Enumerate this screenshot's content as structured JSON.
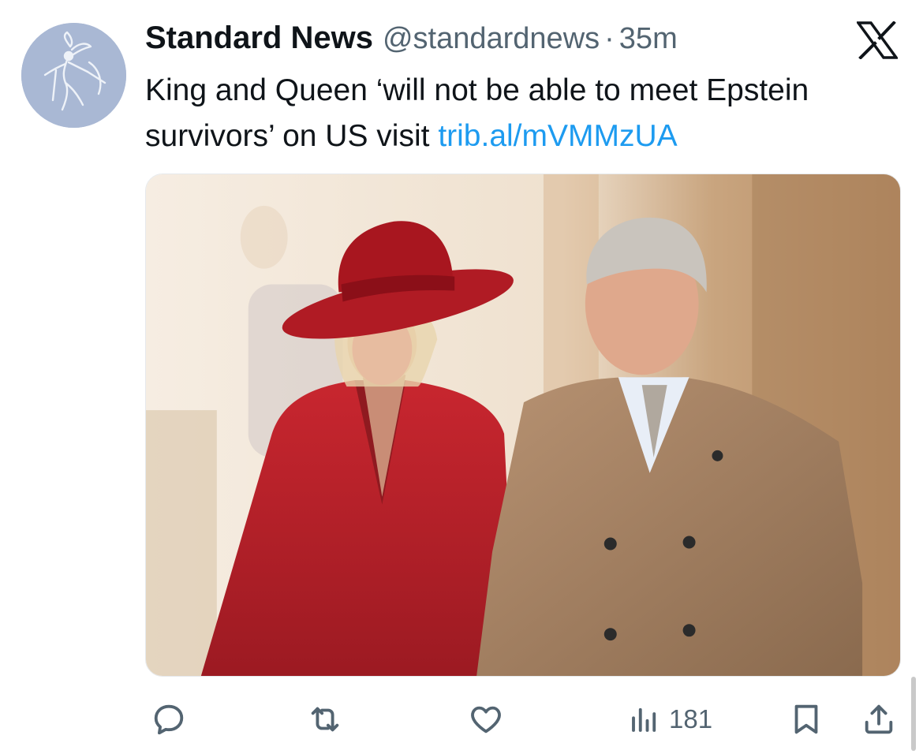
{
  "tweet": {
    "author_name": "Standard News",
    "author_handle": "@standardnews",
    "separator": "·",
    "time": "35m",
    "text_main": "King and Queen ‘will not be able to meet Epstein survivors’ on US visit ",
    "link": "trib.al/mVMMzUA"
  },
  "actions": {
    "reply_icon": "reply-icon",
    "retweet_icon": "retweet-icon",
    "like_icon": "heart-icon",
    "views_icon": "views-icon",
    "views_count": "181",
    "bookmark_icon": "bookmark-icon",
    "share_icon": "share-icon"
  },
  "colors": {
    "text": "#0f1419",
    "secondary": "#536471",
    "link": "#1d9bf0",
    "avatar_bg": "#a9b8d4"
  }
}
